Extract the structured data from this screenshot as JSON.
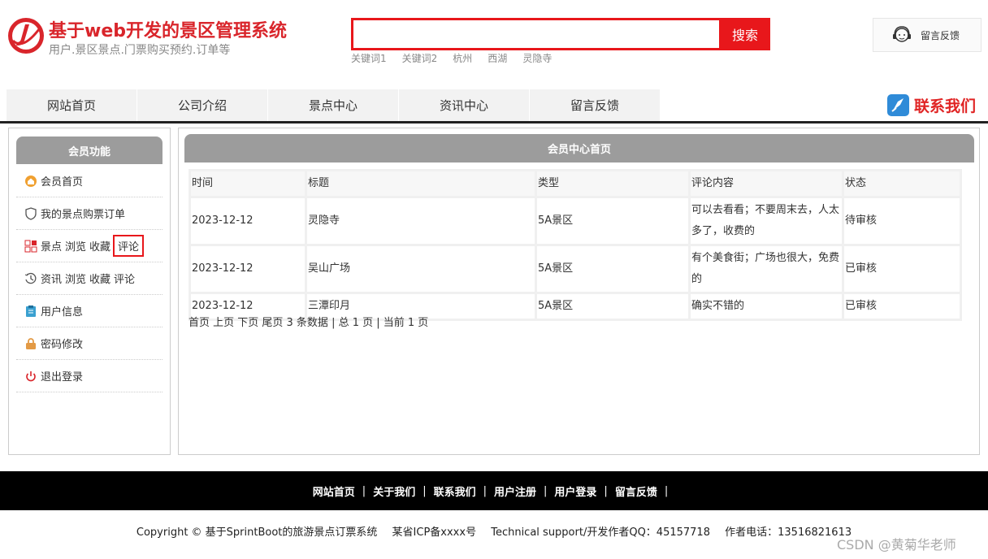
{
  "header": {
    "title": "基于web开发的景区管理系统",
    "subtitle": "用户.景区景点.门票购买预约.订单等",
    "search": {
      "value": "",
      "placeholder": "",
      "button": "搜索"
    },
    "keywords": [
      "关键词1",
      "关键词2",
      "杭州",
      "西湖",
      "灵隐寺"
    ],
    "feedback": "留言反馈",
    "brand_color": "#d9252b"
  },
  "nav": {
    "items": [
      "网站首页",
      "公司介绍",
      "景点中心",
      "资讯中心",
      "留言反馈"
    ],
    "contact": "联系我们"
  },
  "sidebar": {
    "title": "会员功能",
    "items": [
      {
        "icon": "home-icon",
        "label": "会员首页"
      },
      {
        "icon": "shield-icon",
        "label": "我的景点购票订单"
      },
      {
        "icon": "grid-icon",
        "label": "景点",
        "sub1": "浏览",
        "sub2": "收藏",
        "sub3": "评论"
      },
      {
        "icon": "clock-icon",
        "label": "资讯",
        "sub1": "浏览",
        "sub2": "收藏",
        "sub3": "评论"
      },
      {
        "icon": "clipboard-icon",
        "label": "用户信息"
      },
      {
        "icon": "lock-icon",
        "label": "密码修改"
      },
      {
        "icon": "power-icon",
        "label": "退出登录"
      }
    ]
  },
  "main": {
    "title": "会员中心首页",
    "columns": [
      "时间",
      "标题",
      "类型",
      "评论内容",
      "状态"
    ],
    "rows": [
      [
        "2023-12-12",
        "灵隐寺",
        "5A景区",
        "可以去看看；不要周末去，人太多了，收费的",
        "待审核"
      ],
      [
        "2023-12-12",
        "吴山广场",
        "5A景区",
        "有个美食街；广场也很大，免费的",
        "已审核"
      ],
      [
        "2023-12-12",
        "三潭印月",
        "5A景区",
        "确实不错的",
        "已审核"
      ]
    ],
    "pager": "首页 上页 下页 尾页 3 条数据 | 总 1 页 | 当前 1 页"
  },
  "footer": {
    "links": [
      "网站首页",
      "关于我们",
      "联系我们",
      "用户注册",
      "用户登录",
      "留言反馈"
    ],
    "copyright": "Copyright © 基于SprintBoot的旅游景点订票系统",
    "icp": "某省ICP备xxxx号",
    "support": "Technical support/开发作者QQ：45157718",
    "phone": "作者电话：13516821613",
    "watermark": "CSDN @黄菊华老师"
  }
}
